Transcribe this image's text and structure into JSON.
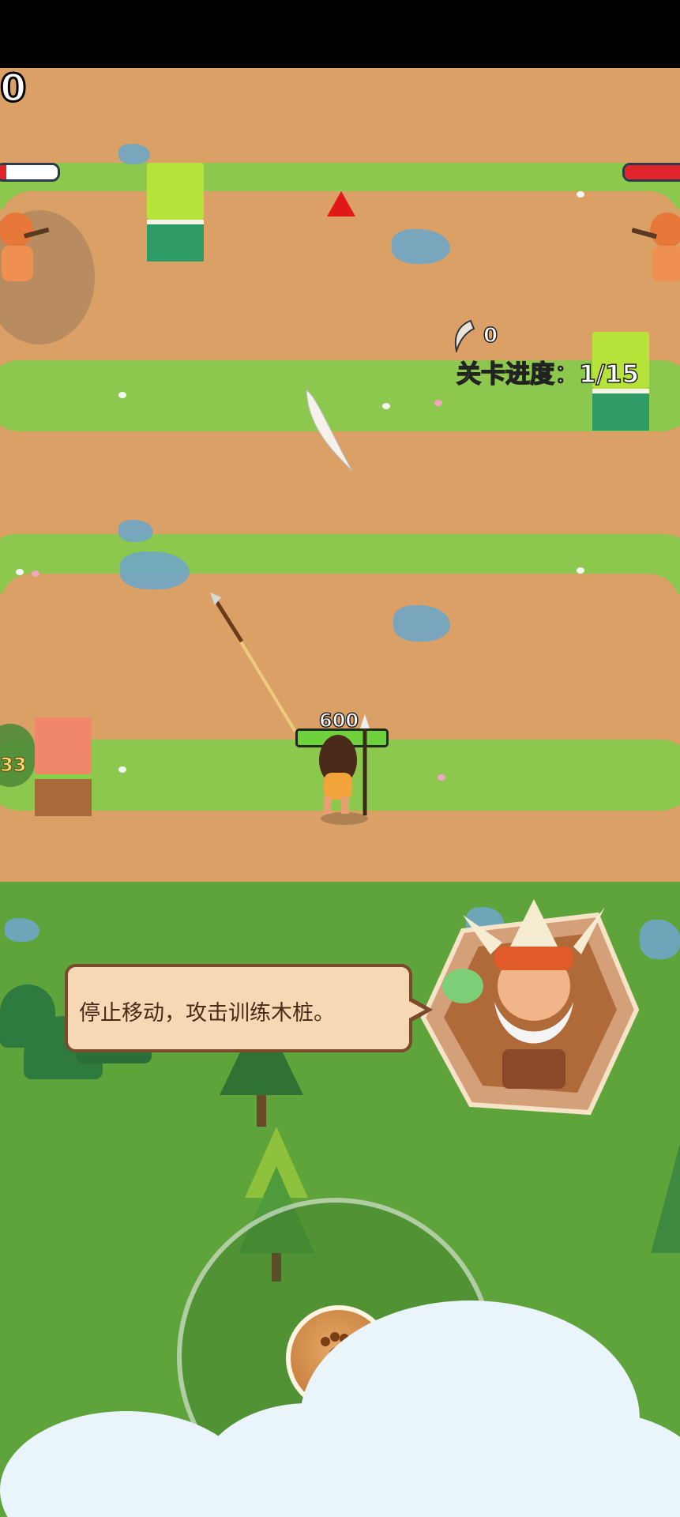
{
  "hud": {
    "score": "0",
    "claw_count": "0",
    "level_progress": "关卡进度：1/15",
    "side_badge_value": "33"
  },
  "player": {
    "hp_value": "600",
    "hp_fraction": 1.0
  },
  "enemies": {
    "left_hp_fraction": 0.15,
    "right_hp_fraction": 0.9
  },
  "tutorial": {
    "message": "停止移动，攻击训练木桩。"
  },
  "icons": {
    "claw": "claw-icon",
    "joystick_knob": "footprint-icon",
    "target_marker": "red-triangle-icon"
  },
  "colors": {
    "dirt": "#dba066",
    "grass": "#8cc84d",
    "hp_red": "#e0242a",
    "hp_green": "#6fd13b",
    "speech_bg": "#f6d9b4"
  }
}
